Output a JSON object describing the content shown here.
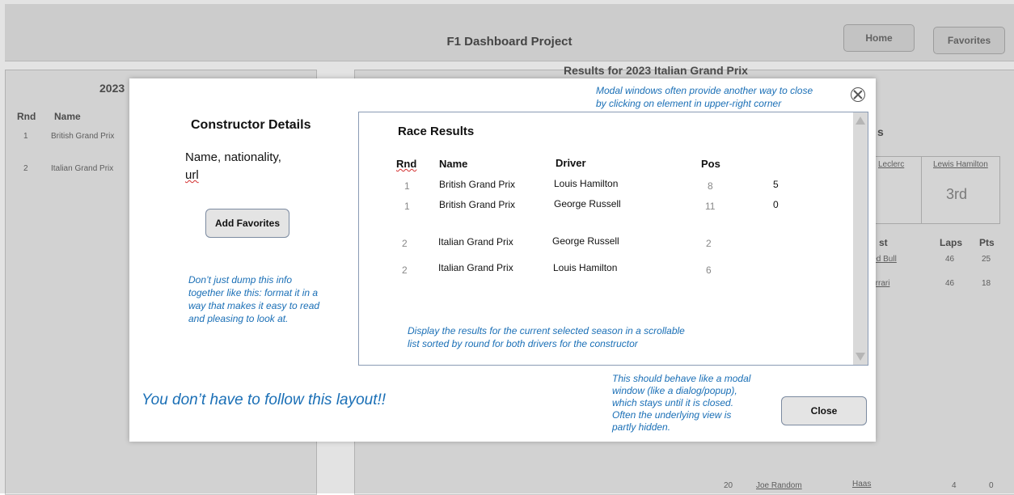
{
  "app": {
    "title": "F1 Dashboard Project",
    "nav": {
      "home": "Home",
      "favorites": "Favorites"
    }
  },
  "background": {
    "left_panel": {
      "heading": "2023",
      "columns": [
        "Rnd",
        "Name"
      ],
      "rows": [
        {
          "rnd": "1",
          "name": "British Grand Prix"
        },
        {
          "rnd": "2",
          "name": "Italian Grand Prix"
        }
      ]
    },
    "right_panel": {
      "heading": "Results for 2023 Italian Grand Prix",
      "section_letter": "s",
      "cards": [
        {
          "name": "Leclerc"
        },
        {
          "name": "Lewis Hamilton",
          "place": "3rd"
        }
      ],
      "columns": [
        "st",
        "Laps",
        "Pts"
      ],
      "rows": [
        {
          "team": "Red Bull",
          "laps": "46",
          "pts": "25"
        },
        {
          "team": "Ferrari",
          "laps": "46",
          "pts": "18"
        }
      ],
      "last_row": {
        "pos": "20",
        "driver": "Joe Random",
        "team": "Haas",
        "laps": "4",
        "pts": "0"
      }
    }
  },
  "modal": {
    "title": "Constructor Details",
    "info_line1": "Name, nationality,",
    "info_line2": "url",
    "add_favorites": "Add Favorites",
    "format_note": [
      "Don’t just dump this info",
      "together like this: format it in a",
      "way that makes it easy to read",
      "and pleasing to look at."
    ],
    "layout_note": "You don’t have to follow this layout!!",
    "close_note": [
      "Modal windows often provide another way to close",
      "by clicking on element in upper-right corner"
    ],
    "modal_note": [
      "This should behave like a modal",
      "window (like a dialog/popup),",
      "which stays until it is closed.",
      "Often the underlying view is",
      "partly hidden."
    ],
    "close_button": "Close",
    "results": {
      "title": "Race Results",
      "columns": [
        "Rnd",
        "Name",
        "Driver",
        "Pos"
      ],
      "rows": [
        {
          "rnd": "1",
          "name": "British Grand Prix",
          "driver": "Louis Hamilton",
          "pos": "8",
          "points": "5"
        },
        {
          "rnd": "1",
          "name": "British Grand Prix",
          "driver": "George Russell",
          "pos": "11",
          "points": "0"
        },
        {
          "rnd": "2",
          "name": "Italian Grand Prix",
          "driver": "George Russell",
          "pos": "2",
          "points": ""
        },
        {
          "rnd": "2",
          "name": "Italian Grand Prix",
          "driver": "Louis Hamilton",
          "pos": "6",
          "points": ""
        }
      ],
      "note": [
        "Display the results for the current selected season in a scrollable",
        "list sorted by round for both drivers for the constructor"
      ]
    }
  }
}
